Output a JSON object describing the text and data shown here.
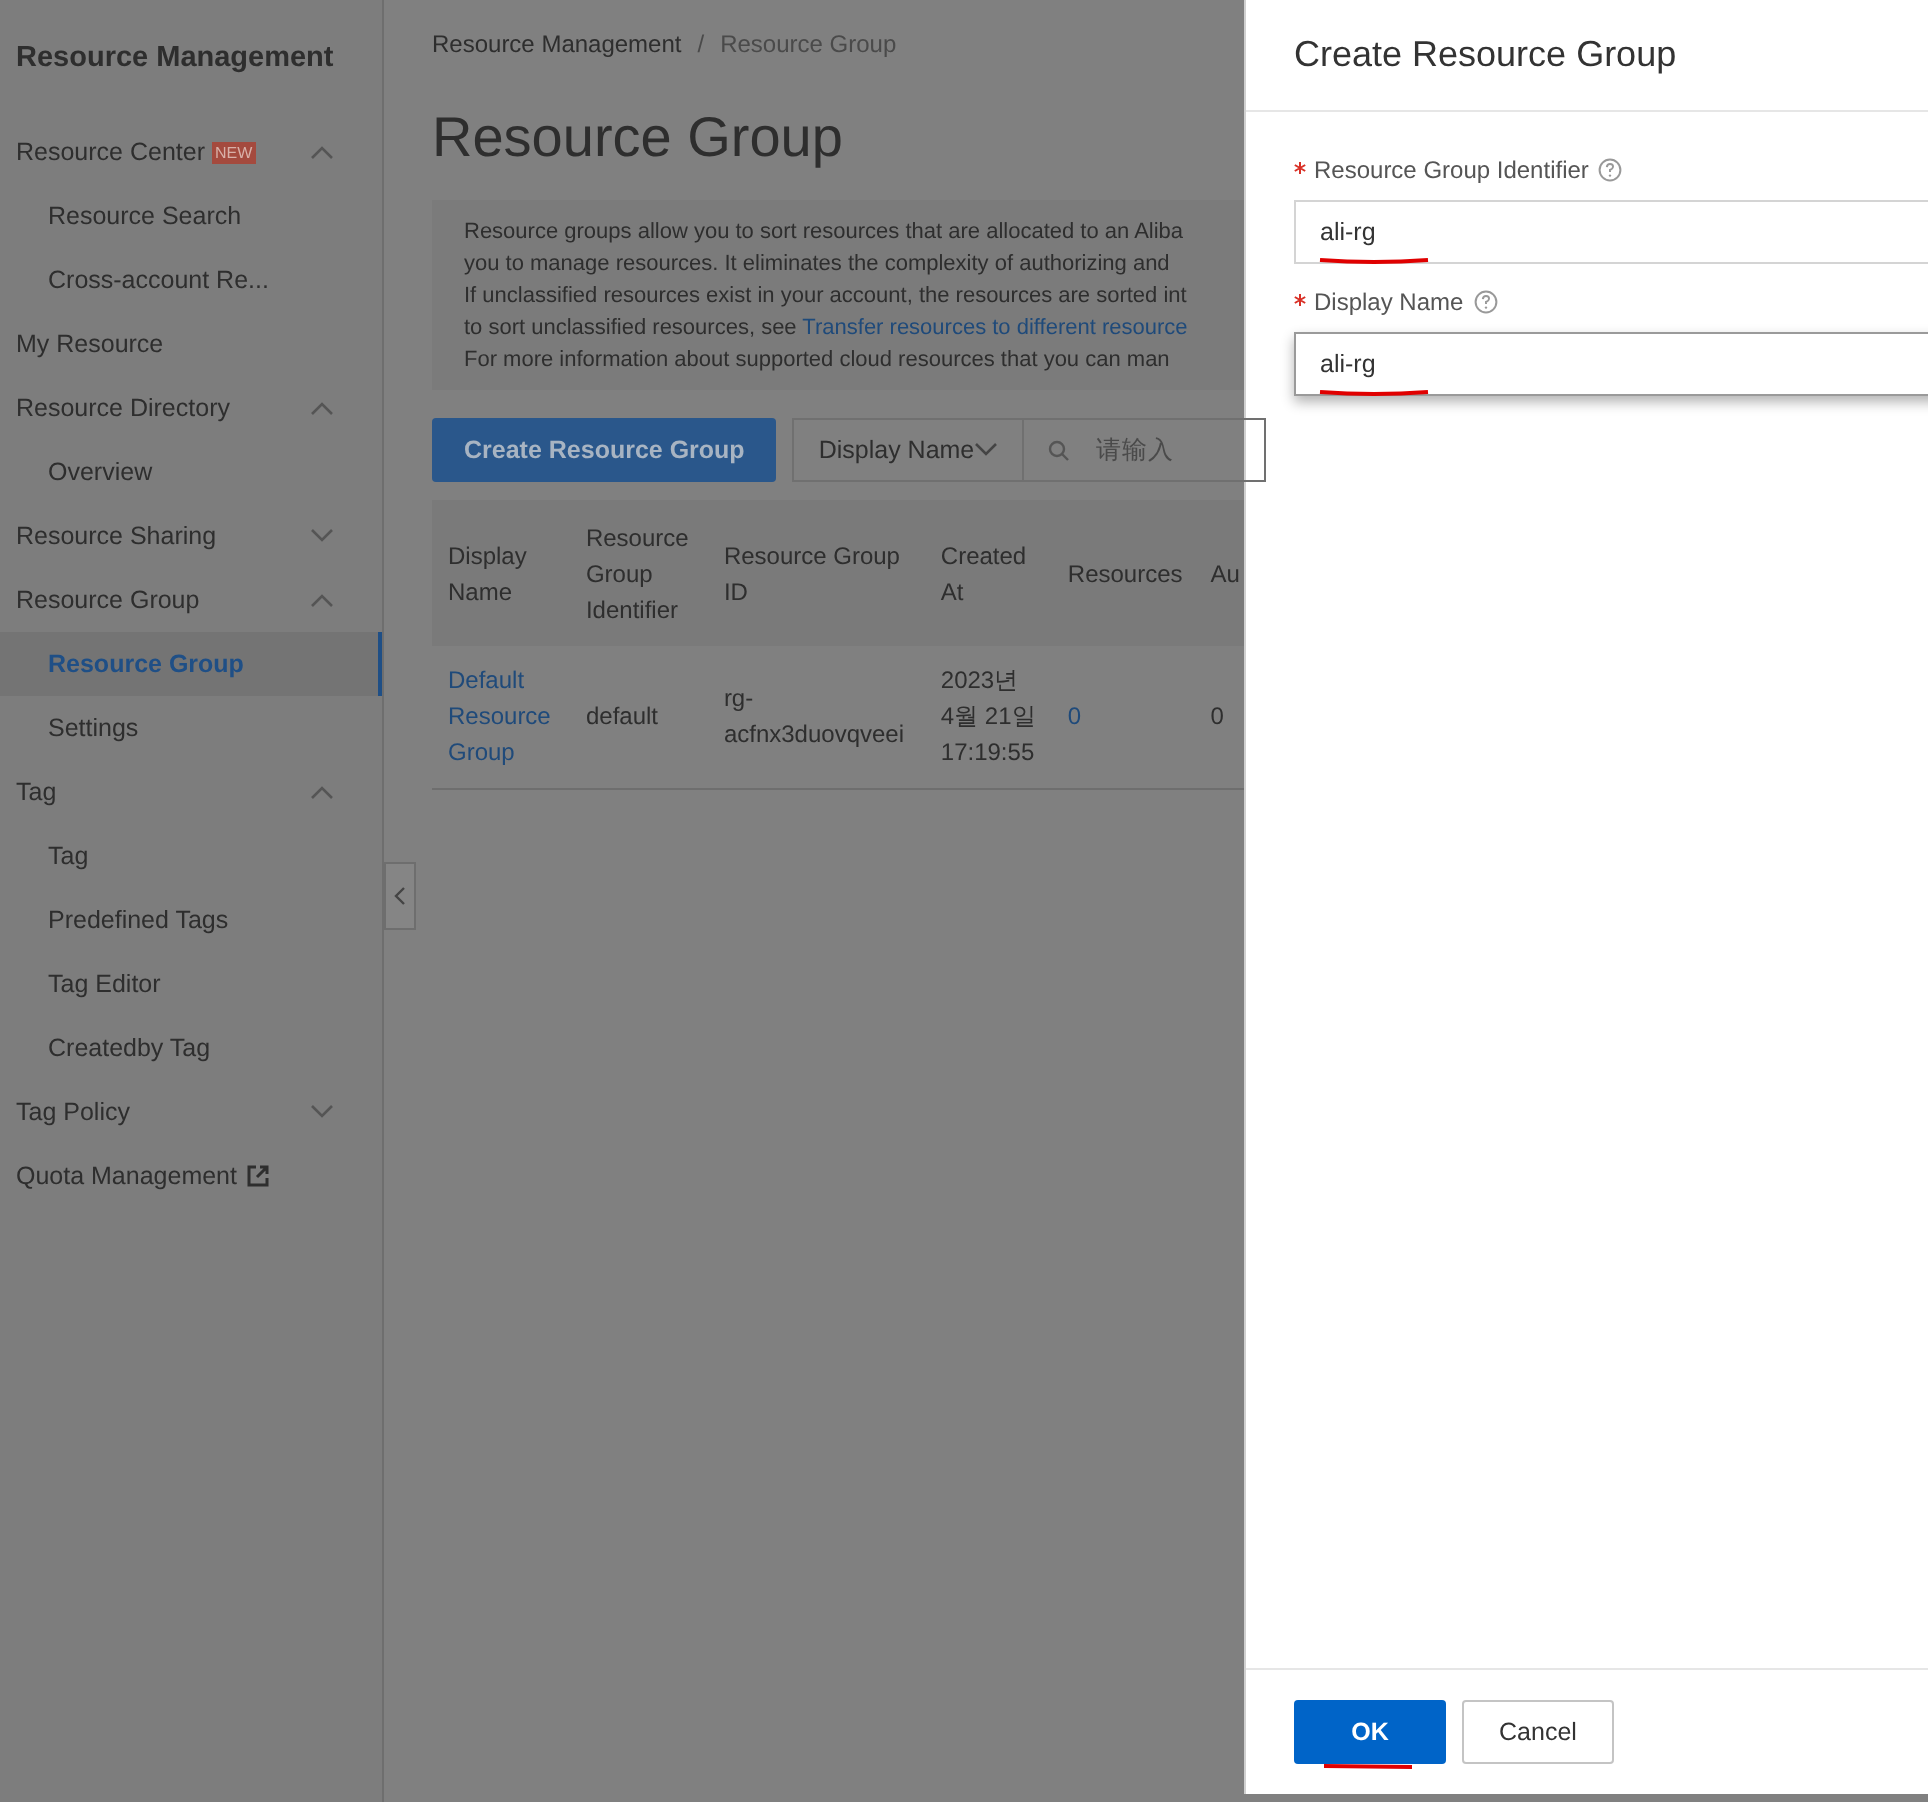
{
  "sidebar": {
    "title": "Resource Management",
    "items": [
      {
        "label": "Resource Center",
        "badge": "NEW",
        "expanded": true,
        "selected": false,
        "children": [
          {
            "label": "Resource Search",
            "selected": false
          },
          {
            "label": "Cross-account Re...",
            "selected": false
          }
        ]
      },
      {
        "label": "My Resource",
        "selected": false
      },
      {
        "label": "Resource Directory",
        "expanded": true,
        "selected": false,
        "children": [
          {
            "label": "Overview",
            "selected": false
          }
        ]
      },
      {
        "label": "Resource Sharing",
        "expanded": false,
        "selected": false
      },
      {
        "label": "Resource Group",
        "expanded": true,
        "selected": false,
        "children": [
          {
            "label": "Resource Group",
            "selected": true
          },
          {
            "label": "Settings",
            "selected": false
          }
        ]
      },
      {
        "label": "Tag",
        "expanded": true,
        "selected": false,
        "children": [
          {
            "label": "Tag",
            "selected": false
          },
          {
            "label": "Predefined Tags",
            "selected": false
          },
          {
            "label": "Tag Editor",
            "selected": false
          },
          {
            "label": "Createdby Tag",
            "selected": false
          }
        ]
      },
      {
        "label": "Tag Policy",
        "expanded": false,
        "selected": false
      },
      {
        "label": "Quota Management",
        "external": true,
        "selected": false
      }
    ]
  },
  "breadcrumb": [
    "Resource Management",
    "/",
    "Resource Group"
  ],
  "page_title": "Resource Group",
  "notice": {
    "lines": [
      {
        "text": "Resource groups allow you to sort resources that are allocated to an Aliba"
      },
      {
        "text": "you to manage resources. It eliminates the complexity of authorizing and"
      },
      {
        "text": "If unclassified resources exist in your account, the resources are sorted int"
      },
      {
        "text": "to sort unclassified resources, see ",
        "link": "Transfer resources to different resource"
      },
      {
        "text": "For more information about supported cloud resources that you can man"
      }
    ]
  },
  "toolbar": {
    "create_button": "Create Resource Group",
    "filter": "Display Name",
    "search": {
      "placeholder": "请输入"
    }
  },
  "table": {
    "columns": [
      "Display Name",
      "Resource Group Identifier",
      "Resource Group ID",
      "Created At",
      "Resources",
      "Au"
    ],
    "rows": [
      {
        "cells": [
          "Default Resource Group",
          "default",
          "rg-acfnx3duovqveei",
          "2023년 4월 21일 17:19:55",
          "0",
          "0"
        ]
      }
    ]
  },
  "drawer": {
    "title": "Create Resource Group",
    "fields": [
      {
        "label": "Resource Group Identifier",
        "required": true,
        "value": "ali-rg",
        "underlined": true,
        "focused": false
      },
      {
        "label": "Display Name",
        "required": true,
        "value": "ali-rg",
        "underlined": true,
        "focused": true
      }
    ],
    "buttons": [
      {
        "label": "OK",
        "kind": "primary",
        "underlined": true
      },
      {
        "label": "Cancel",
        "kind": "secondary",
        "underlined": false
      }
    ]
  }
}
